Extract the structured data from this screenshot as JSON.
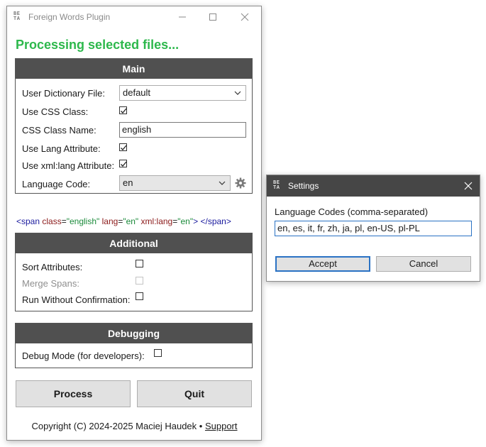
{
  "main_window": {
    "badge": [
      "BE",
      "TA"
    ],
    "title": "Foreign Words Plugin",
    "status": "Processing selected files...",
    "main_section": {
      "header": "Main",
      "user_dictionary_label": "User Dictionary File:",
      "user_dictionary_value": "default",
      "use_css_class_label": "Use CSS Class:",
      "use_css_class_checked": true,
      "css_class_name_label": "CSS Class Name:",
      "css_class_name_value": "english",
      "use_lang_label": "Use Lang Attribute:",
      "use_lang_checked": true,
      "use_xml_lang_label": "Use xml:lang Attribute:",
      "use_xml_lang_checked": true,
      "language_code_label": "Language Code:",
      "language_code_value": "en"
    },
    "preview": {
      "open_tag": "<span",
      "class_attr": "class",
      "class_value": "\"english\"",
      "lang_attr": "lang",
      "lang_value": "\"en\"",
      "xml_lang_attr": "xml:lang",
      "xml_lang_value": "\"en\"",
      "close_open": ">",
      "close_tag": "</span>"
    },
    "additional_section": {
      "header": "Additional",
      "sort_attributes_label": "Sort Attributes:",
      "sort_attributes_checked": false,
      "merge_spans_label": "Merge Spans:",
      "merge_spans_checked": false,
      "merge_spans_disabled": true,
      "run_without_confirmation_label": "Run Without Confirmation:",
      "run_without_confirmation_checked": false
    },
    "debugging_section": {
      "header": "Debugging",
      "debug_mode_label": "Debug Mode (for developers):",
      "debug_mode_checked": false
    },
    "process_button": "Process",
    "quit_button": "Quit",
    "footer_text": "Copyright (C) 2024-2025 Maciej Haudek •",
    "footer_link": "Support"
  },
  "settings_dialog": {
    "badge": [
      "BE",
      "TA"
    ],
    "title": "Settings",
    "label": "Language Codes (comma-separated)",
    "value": "en, es, it, fr, zh, ja, pl, en-US, pl-PL",
    "accept_button": "Accept",
    "cancel_button": "Cancel"
  },
  "colors": {
    "status_green": "#2db84c",
    "section_header": "#505050",
    "focus_blue": "#2a72c4"
  }
}
